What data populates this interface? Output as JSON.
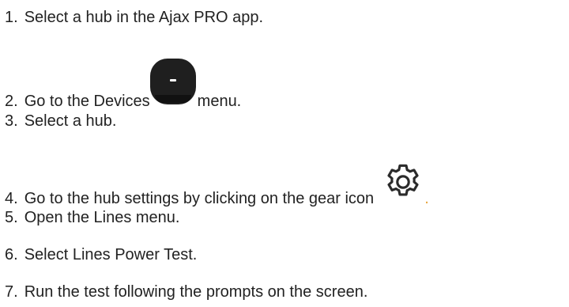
{
  "steps": [
    {
      "num": "1",
      "text": "Select a hub in the Ajax PRO app."
    },
    {
      "num": "2",
      "text": "Go to the Devices",
      "icon": "devices-tab-icon",
      "after": "menu."
    },
    {
      "num": "3",
      "text": "Select a hub."
    },
    {
      "num": "4",
      "text": "Go to the hub settings by clicking on the gear icon",
      "icon": "gear-icon",
      "after": "."
    },
    {
      "num": "5",
      "text": "Open the Lines menu."
    },
    {
      "num": "6",
      "text": "Select Lines Power Test."
    },
    {
      "num": "7",
      "text": "Run the test following the prompts on the screen."
    }
  ],
  "colors": {
    "text": "#222222",
    "devices_icon_bg": "#1f1f1f",
    "gear_stroke": "#2b2b2b",
    "accent_dot": "#e8a33a"
  }
}
